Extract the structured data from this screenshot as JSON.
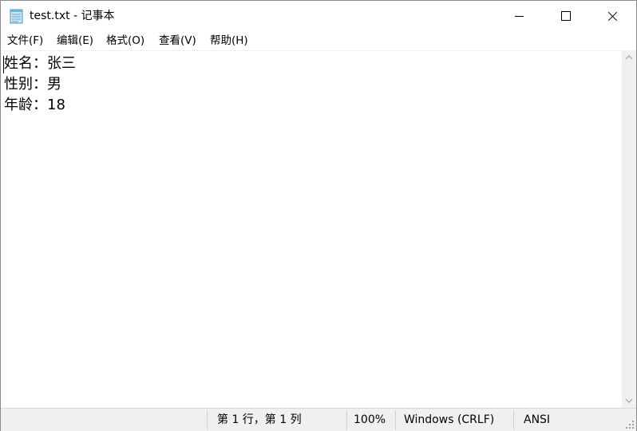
{
  "window": {
    "title": "test.txt - 记事本"
  },
  "menu": {
    "items": [
      {
        "label": "文件(F)"
      },
      {
        "label": "编辑(E)"
      },
      {
        "label": "格式(O)"
      },
      {
        "label": "查看(V)"
      },
      {
        "label": "帮助(H)"
      }
    ]
  },
  "editor": {
    "lines": [
      "姓名：张三",
      "性别：男",
      "年龄：18"
    ]
  },
  "status": {
    "position": "第 1 行，第 1 列",
    "zoom": "100%",
    "line_ending": "Windows (CRLF)",
    "encoding": "ANSI"
  },
  "icons": {
    "app": "notepad-icon",
    "minimize": "minimize-icon",
    "maximize": "maximize-icon",
    "close": "close-icon"
  }
}
